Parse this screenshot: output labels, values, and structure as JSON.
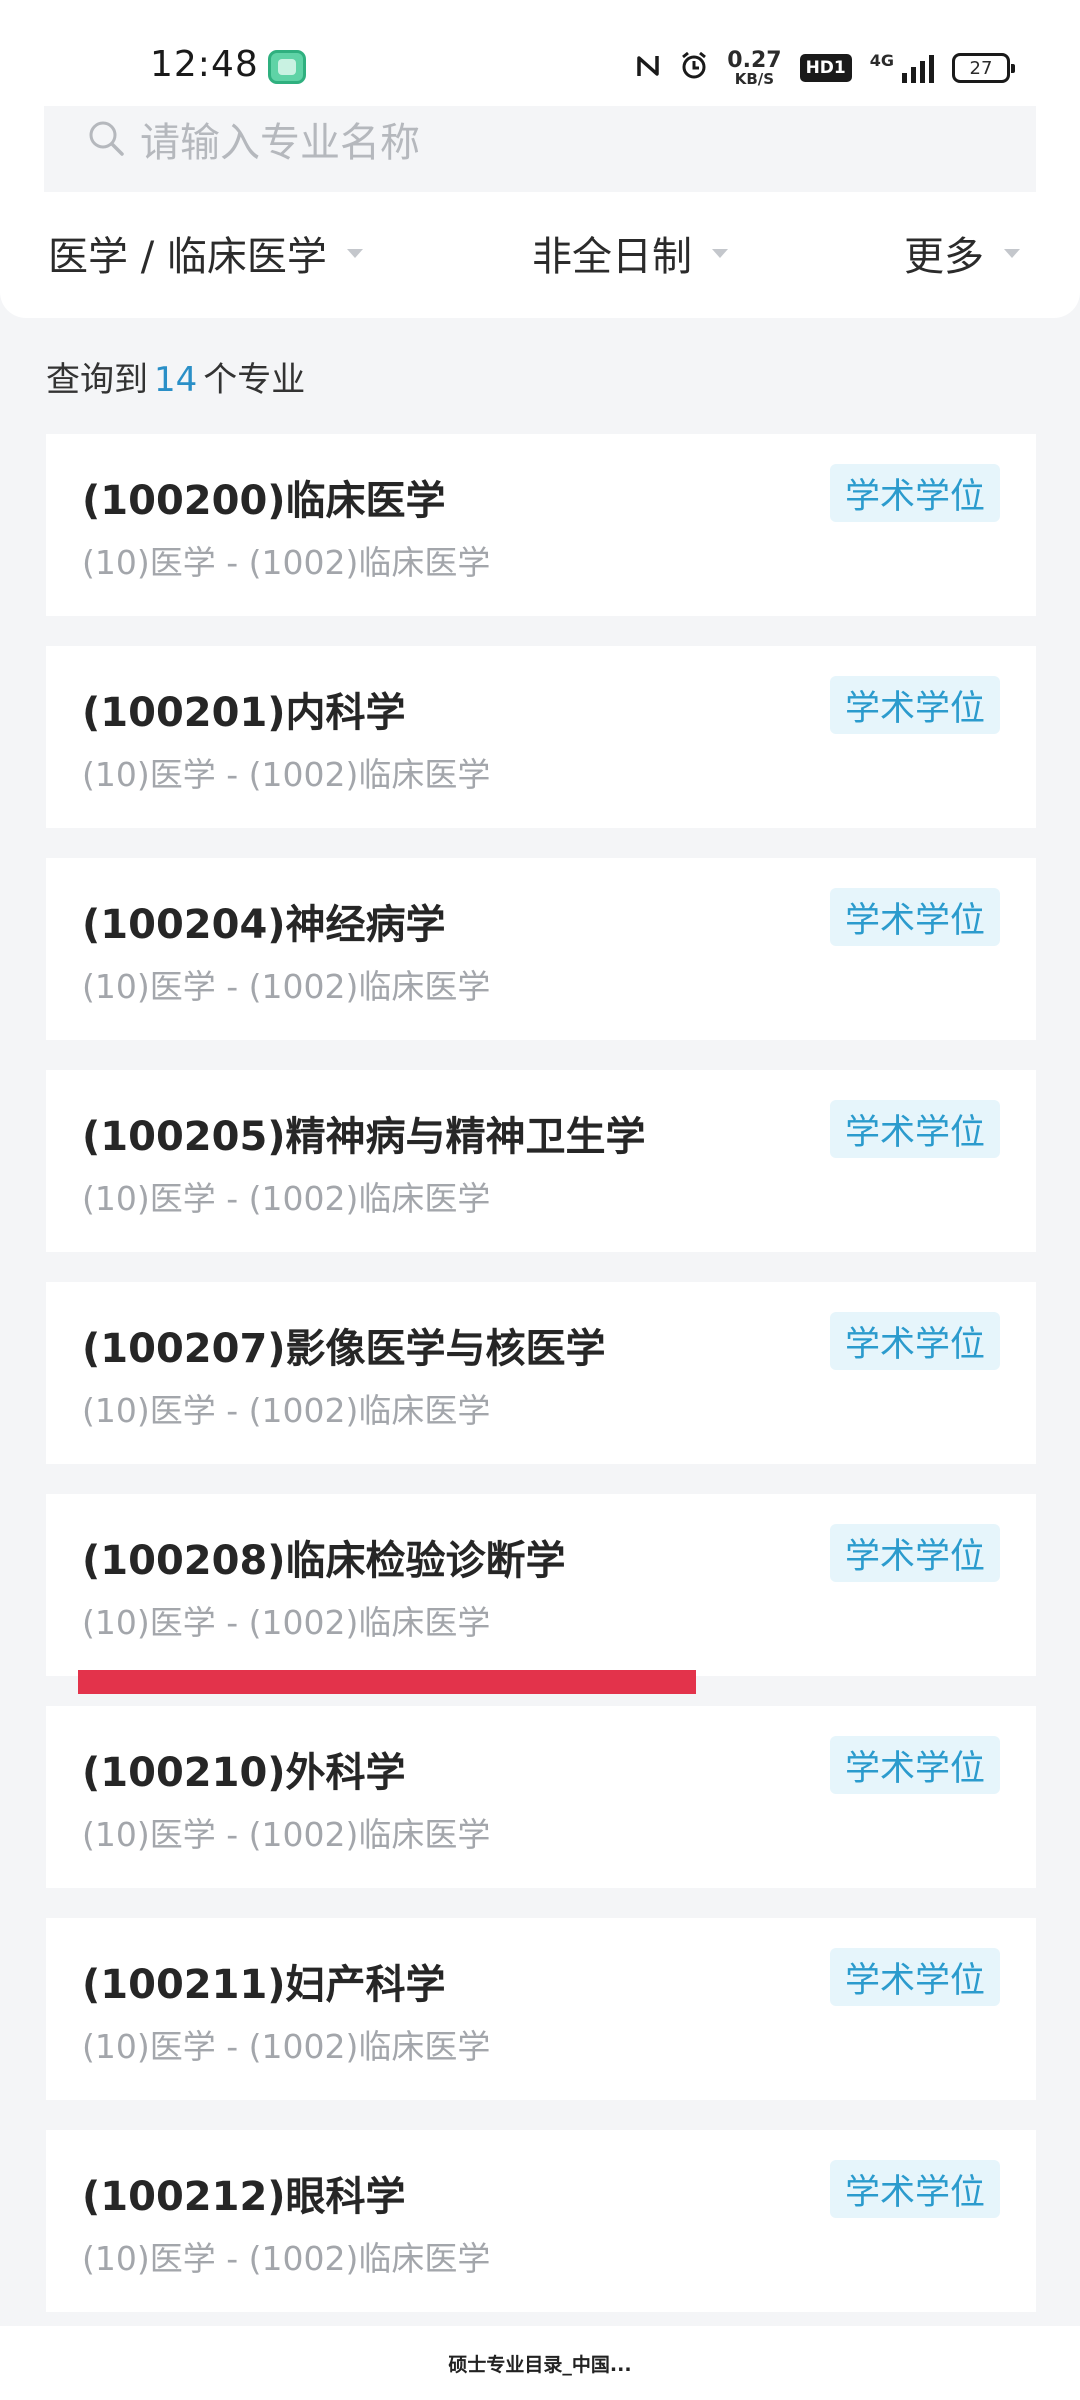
{
  "status_bar": {
    "time": "12:48",
    "speed_value": "0.27",
    "speed_unit": "KB/S",
    "hd_label": "HD1",
    "network_label": "4G",
    "battery": "27",
    "icons": [
      "nfc-icon",
      "alarm-icon",
      "hd-voice-icon",
      "signal-icon",
      "battery-icon"
    ]
  },
  "search": {
    "placeholder": "请输入专业名称"
  },
  "filters": {
    "category": "医学 / 临床医学",
    "study_mode": "非全日制",
    "more": "更多"
  },
  "result": {
    "prefix": "查询到",
    "count": "14",
    "suffix": "个专业"
  },
  "majors": [
    {
      "title": "(100200)临床医学",
      "subtitle": "(10)医学 - (1002)临床医学",
      "badge": "学术学位"
    },
    {
      "title": "(100201)内科学",
      "subtitle": "(10)医学 - (1002)临床医学",
      "badge": "学术学位"
    },
    {
      "title": "(100204)神经病学",
      "subtitle": "(10)医学 - (1002)临床医学",
      "badge": "学术学位"
    },
    {
      "title": "(100205)精神病与精神卫生学",
      "subtitle": "(10)医学 - (1002)临床医学",
      "badge": "学术学位"
    },
    {
      "title": "(100207)影像医学与核医学",
      "subtitle": "(10)医学 - (1002)临床医学",
      "badge": "学术学位"
    },
    {
      "title": "(100208)临床检验诊断学",
      "subtitle": "(10)医学 - (1002)临床医学",
      "badge": "学术学位"
    },
    {
      "title": "(100210)外科学",
      "subtitle": "(10)医学 - (1002)临床医学",
      "badge": "学术学位"
    },
    {
      "title": "(100211)妇产科学",
      "subtitle": "(10)医学 - (1002)临床医学",
      "badge": "学术学位"
    },
    {
      "title": "(100212)眼科学",
      "subtitle": "(10)医学 - (1002)临床医学",
      "badge": "学术学位"
    }
  ],
  "colors": {
    "accent_blue": "#2a8fc7",
    "badge_bg": "#e6f5fb",
    "highlight_red": "#e3334b"
  },
  "bottom_bar": {
    "title": "硕士专业目录_中国..."
  }
}
